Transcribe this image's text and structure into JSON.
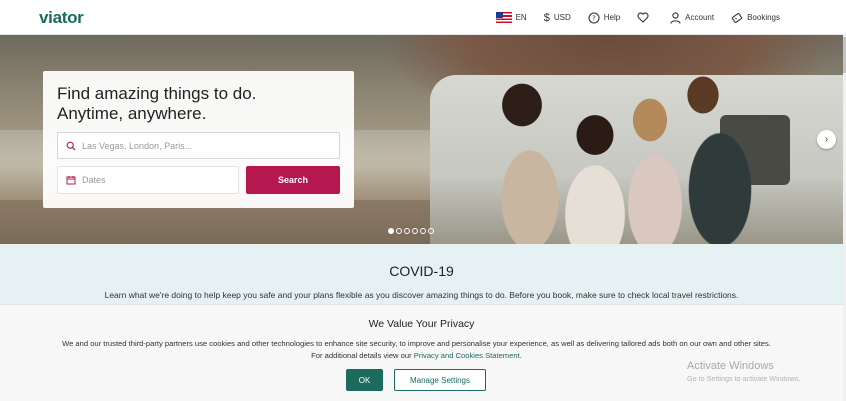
{
  "header": {
    "logo": "viator",
    "language": "EN",
    "currency_symbol": "$",
    "currency": "USD",
    "help": "Help",
    "account": "Account",
    "bookings": "Bookings"
  },
  "hero": {
    "title_line1": "Find amazing things to do.",
    "title_line2": "Anytime, anywhere.",
    "search_placeholder": "Las Vegas, London, Paris...",
    "dates_placeholder": "Dates",
    "search_button": "Search",
    "carousel_next": "›",
    "carousel_dots": 6,
    "carousel_active": 1
  },
  "covid": {
    "title": "COVID-19",
    "text": "Learn what we're doing to help keep you safe and your plans flexible as you discover amazing things to do. Before you book, make sure to check local travel restrictions."
  },
  "cookie": {
    "title": "We Value Your Privacy",
    "line1": "We and our trusted third-party partners use cookies and other technologies to enhance site security, to improve and personalise your experience, as well as delivering tailored ads both on our own and other sites.",
    "line2_prefix": "For additional details view our",
    "link": "Privacy and Cookies Statement",
    "line2_suffix": ".",
    "ok": "OK",
    "manage": "Manage Settings"
  },
  "watermark": {
    "title": "Activate Windows",
    "subtitle": "Go to Settings to activate Windows."
  },
  "colors": {
    "brand": "#1b6b5f",
    "search_button": "#b5174f",
    "covid_bg": "#e6f1f3"
  }
}
